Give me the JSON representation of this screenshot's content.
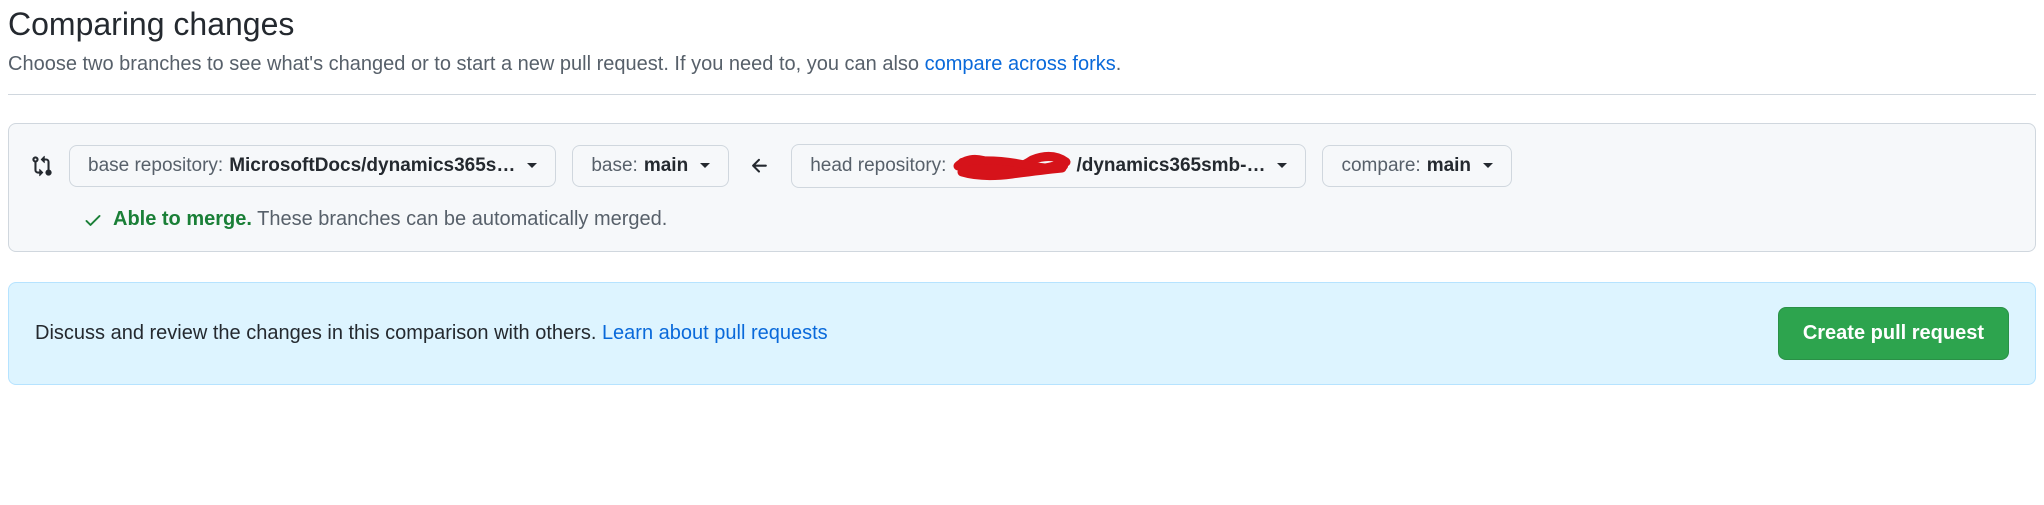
{
  "header": {
    "title": "Comparing changes",
    "subtitle_prefix": "Choose two branches to see what's changed or to start a new pull request. If you need to, you can also ",
    "compare_forks_link": "compare across forks",
    "subtitle_suffix": "."
  },
  "selectors": {
    "base_repo_label": "base repository: ",
    "base_repo_value": "MicrosoftDocs/dynamics365s…",
    "base_branch_label": "base: ",
    "base_branch_value": "main",
    "head_repo_label": "head repository: ",
    "head_repo_value": "/dynamics365smb-…",
    "compare_branch_label": "compare: ",
    "compare_branch_value": "main"
  },
  "merge": {
    "status_label": "Able to merge.",
    "status_detail": "These branches can be automatically merged."
  },
  "pr_prompt": {
    "text": "Discuss and review the changes in this comparison with others. ",
    "learn_link": "Learn about pull requests",
    "create_button": "Create pull request"
  }
}
